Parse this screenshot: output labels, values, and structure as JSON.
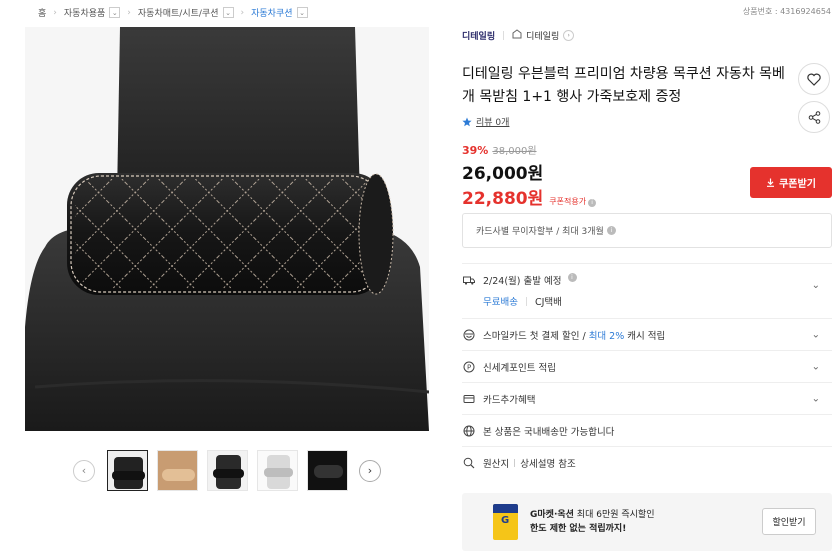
{
  "breadcrumb": {
    "home": "홈",
    "level1": "자동차용품",
    "level2": "자동차매트/시트/쿠션",
    "level3": "자동차쿠션"
  },
  "product_number": "상품번호 : 4316924654",
  "shop": {
    "brand": "디테일링",
    "store_name": "디테일링"
  },
  "product": {
    "title": "디테일링 우븐블럭 프리미엄 차량용 목쿠션 자동차 목베개 목받침 1+1 행사 가죽보호제 증정",
    "review_label": "리뷰 0개"
  },
  "price": {
    "discount_rate": "39%",
    "original": "38,000원",
    "sale": "26,000원",
    "coupon_price": "22,880원",
    "coupon_tag": "쿠폰적용가",
    "coupon_button": "쿠폰받기"
  },
  "card_installment": "카드사별 무이자할부 / 최대 3개월",
  "shipping": {
    "date": "2/24(월) 출발 예정",
    "free": "무료배송",
    "courier": "CJ택배"
  },
  "benefits": [
    {
      "icon": "smile-card-icon",
      "text": "스마일카드 첫 결제 할인 / ",
      "highlight": "최대 2%",
      "suffix": " 캐시 적립"
    },
    {
      "icon": "point-icon",
      "text": "신세계포인트 적립"
    },
    {
      "icon": "card-icon",
      "text": "카드추가혜택"
    }
  ],
  "notices": [
    {
      "icon": "globe-icon",
      "text": "본 상품은 국내배송만 가능합니다"
    },
    {
      "icon": "origin-search-icon",
      "label": "원산지",
      "text": "상세설명 참조"
    }
  ],
  "promo": {
    "line1_bold": "G마켓·옥션",
    "line1_rest": " 최대 6만원 즉시할인",
    "line2": "한도 제한 없는 적립까지!",
    "button": "할인받기"
  },
  "colors": {
    "accent_red": "#e5322d",
    "link_blue": "#2d7bd6"
  }
}
